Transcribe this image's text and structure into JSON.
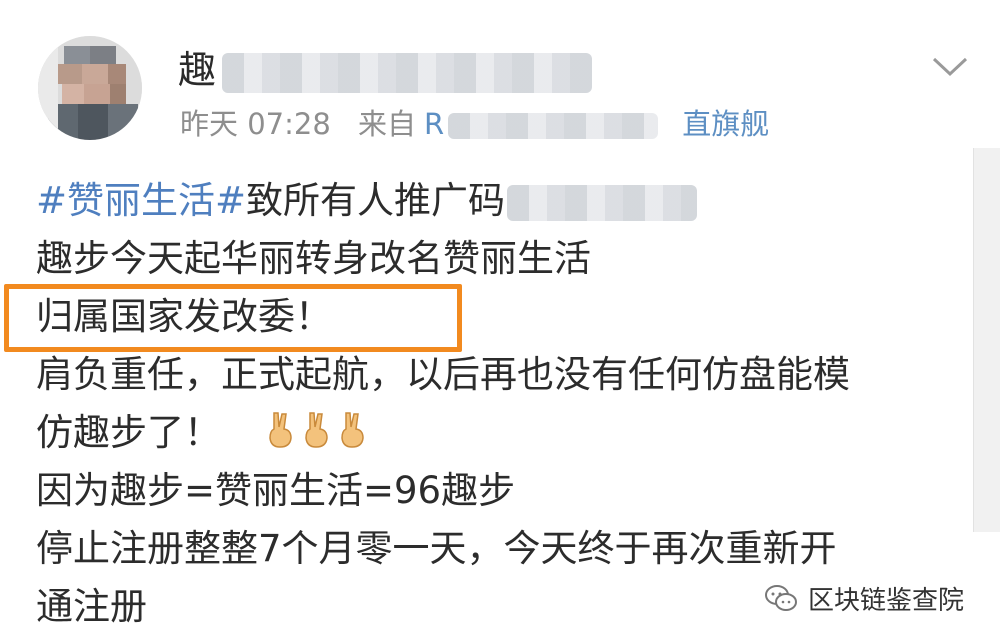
{
  "post": {
    "username_visible": "趣",
    "time": "昨天 07:28",
    "source_prefix": "来自",
    "source_head": "R",
    "source_tail": "直旗舰"
  },
  "content": {
    "line1_tag1": "#赞丽生活#",
    "line1_text": "致所有人推广码",
    "line2": "趣步今天起华丽转身改名赞丽生活",
    "line3": "归属国家发改委！",
    "line4": "肩负重任，正式起航，以后再也没有任何仿盘能模",
    "line5": "仿趣步了！",
    "line6": "因为趣步=赞丽生活=96趣步",
    "line7": "停止注册整整7个月零一天，今天终于再次重新开",
    "line8": "通注册"
  },
  "watermark": {
    "label": "区块链鉴查院"
  },
  "colors": {
    "hashtag": "#4f7fbf",
    "highlight_border": "#f28a1f",
    "meta": "#8e8e8e"
  },
  "icons": [
    "expand-chevron-icon",
    "victory-hand-emoji",
    "wechat-watermark-icon"
  ]
}
